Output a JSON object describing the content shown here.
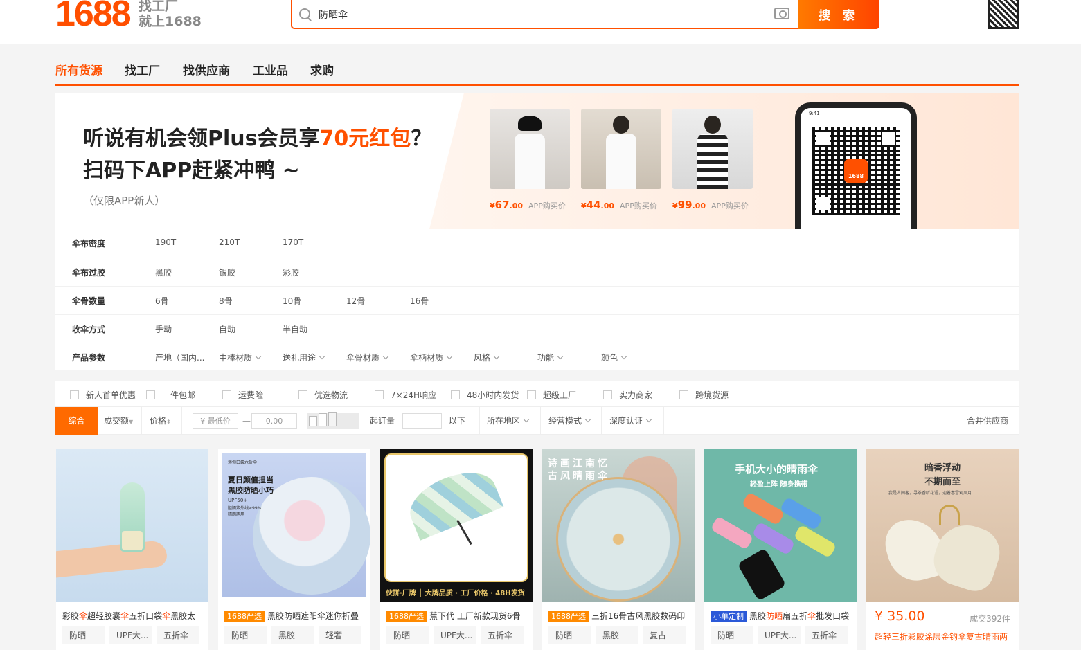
{
  "header": {
    "logo": "1688",
    "slogan_line1": "找工厂",
    "slogan_line2": "就上1688",
    "search_value": "防晒伞",
    "search_button": "搜 索"
  },
  "nav": {
    "items": [
      "所有货源",
      "找工厂",
      "找供应商",
      "工业品",
      "求购"
    ]
  },
  "banner": {
    "title_line1_pre": "听说有机会领Plus会员享",
    "title_line1_highlight": "70元红包",
    "title_line1_post": "？",
    "title_line2": "扫码下APP赶紧冲鸭 ~",
    "note": "（仅限APP新人）",
    "products": [
      {
        "price_symbol": "¥",
        "price_int": "67",
        "price_dec": ".00",
        "tag": "APP购买价"
      },
      {
        "price_symbol": "¥",
        "price_int": "44",
        "price_dec": ".00",
        "tag": "APP购买价"
      },
      {
        "price_symbol": "¥",
        "price_int": "99",
        "price_dec": ".00",
        "tag": "APP购买价"
      }
    ],
    "phone_time": "9:41",
    "qr_logo": "1688"
  },
  "filters": [
    {
      "label": "伞布密度",
      "options": [
        "190T",
        "210T",
        "170T"
      ]
    },
    {
      "label": "伞布过胶",
      "options": [
        "黑胶",
        "银胶",
        "彩胶"
      ]
    },
    {
      "label": "伞骨数量",
      "options": [
        "6骨",
        "8骨",
        "10骨",
        "12骨",
        "16骨"
      ]
    },
    {
      "label": "收伞方式",
      "options": [
        "手动",
        "自动",
        "半自动"
      ]
    },
    {
      "label": "产品参数",
      "options": [
        "产地（国内...",
        "中棒材质",
        "送礼用途",
        "伞骨材质",
        "伞柄材质",
        "风格",
        "功能",
        "颜色"
      ]
    }
  ],
  "services": [
    "新人首单优惠",
    "一件包邮",
    "运费险",
    "优选物流",
    "7×24H响应",
    "48小时内发货",
    "超级工厂",
    "实力商家",
    "跨境货源"
  ],
  "sortbar": {
    "comprehensive": "综合",
    "volume": "成交额",
    "price": "价格",
    "min_price_placeholder": "¥ 最低价",
    "dash": "—",
    "max_price_placeholder": "0.00",
    "moq_label": "起订量",
    "below": "以下",
    "region": "所在地区",
    "business_mode": "经营模式",
    "certification": "深度认证",
    "merge": "合并供应商"
  },
  "products": [
    {
      "title_parts": [
        "彩胶",
        "伞",
        "超轻胶囊",
        "伞",
        "五折口袋",
        "伞",
        "黑胶太"
      ],
      "badge": "",
      "tags": [
        "防晒",
        "UPF大...",
        "五折伞"
      ]
    },
    {
      "title_parts": [
        "黑胶防晒遮阳伞迷你折叠"
      ],
      "badge": "1688严选",
      "tags": [
        "防晒",
        "黑胶",
        "轻奢"
      ],
      "img_lines": [
        "迷你口袋六折伞",
        "夏日颜值担当",
        "黑胶防晒小巧",
        "UPF50+",
        "阻隔紫外线≥99%",
        "晴雨两用"
      ]
    },
    {
      "title_parts": [
        "蕉下代 工厂新款现货6骨"
      ],
      "badge": "1688严选",
      "tags": [
        "防晒",
        "UPF大...",
        "五折伞"
      ],
      "img_footer": "伙拼·厂牌 │ 大牌品质 · 工厂价格 · 48H发货"
    },
    {
      "title_parts": [
        "三折16骨古风黑胶数码印"
      ],
      "badge": "1688严选",
      "tags": [
        "防晒",
        "黑胶",
        "复古"
      ],
      "img_lines": [
        "诗画江南忆",
        "古风晴雨伞"
      ]
    },
    {
      "title_parts": [
        "黑胶",
        "防晒",
        "扁五折",
        "伞",
        "批发口袋"
      ],
      "badge": "小单定制",
      "tags": [
        "防晒",
        "UPF大...",
        "五折伞"
      ],
      "img_lines": [
        "手机大小的晴雨伞",
        "轻盈上阵 随身携带"
      ]
    },
    {
      "price": "¥ 35.00",
      "sold": "成交392件",
      "title": "超轻三折彩胶涂层金钩伞复古晴雨两",
      "img_lines": [
        "暗香浮动",
        "不期而至",
        "我是人间客，寻茶香听花语，迎着春雪观风月"
      ]
    }
  ],
  "colors": {
    "accent": "#ff5000",
    "badge_orange": "#ff8a00",
    "badge_blue": "#2b59d8"
  }
}
